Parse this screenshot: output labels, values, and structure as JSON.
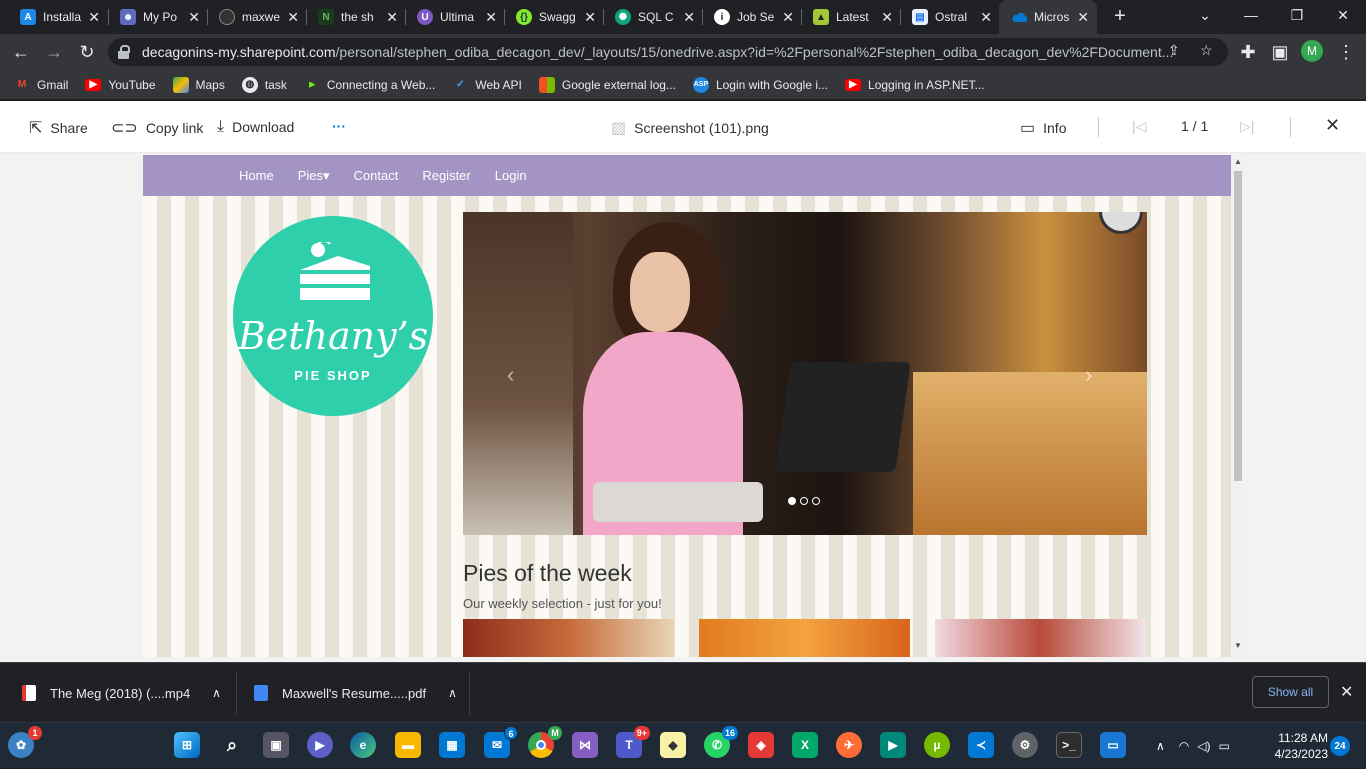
{
  "browser": {
    "tabs": [
      {
        "title": "Installa",
        "icon": "azure-icon",
        "color": "#1e88e5"
      },
      {
        "title": "My Po",
        "icon": "person-icon",
        "color": "#5c6bc0"
      },
      {
        "title": "maxwe",
        "icon": "github-icon",
        "color": "#333333"
      },
      {
        "title": "the sh",
        "icon": "nodejs-icon",
        "color": "#2e7d32"
      },
      {
        "title": "Ultima",
        "icon": "u-icon",
        "color": "#7e57c2"
      },
      {
        "title": "Swagg",
        "icon": "swagger-icon",
        "color": "#85ea2d"
      },
      {
        "title": "SQL C",
        "icon": "openai-icon",
        "color": "#10a37f"
      },
      {
        "title": "Job Se",
        "icon": "info-icon",
        "color": "#ffffff"
      },
      {
        "title": "Latest",
        "icon": "android-icon",
        "color": "#a4c639"
      },
      {
        "title": "Ostral",
        "icon": "doc-icon",
        "color": "#8ab4f8"
      },
      {
        "title": "Micros",
        "icon": "onedrive-icon",
        "color": "#0078d4",
        "active": true
      }
    ],
    "url_host": "decagonins-my.sharepoint.com",
    "url_path": "/personal/stephen_odiba_decagon_dev/_layouts/15/onedrive.aspx?id=%2Fpersonal%2Fstephen_odiba_decagon_dev%2FDocument...",
    "profile_initial": "M",
    "bookmarks": [
      {
        "label": "Gmail",
        "icon": "gmail-icon",
        "color": "#ea4335"
      },
      {
        "label": "YouTube",
        "icon": "youtube-icon",
        "color": "#ff0000"
      },
      {
        "label": "Maps",
        "icon": "maps-icon",
        "color": "#34a853"
      },
      {
        "label": "task",
        "icon": "globe-icon",
        "color": "#e8eaed"
      },
      {
        "label": "Connecting a Web...",
        "icon": "strapi-icon",
        "color": "#76ff03"
      },
      {
        "label": "Web API",
        "icon": "flutter-icon",
        "color": "#42a5f5"
      },
      {
        "label": "Google external log...",
        "icon": "microsoft-icon",
        "color": "#f25022"
      },
      {
        "label": "Login with Google i...",
        "icon": "aspnet-icon",
        "color": "#1e88e5"
      },
      {
        "label": "Logging in ASP.NET...",
        "icon": "youtube-icon",
        "color": "#ff0000"
      }
    ]
  },
  "onedrive": {
    "share": "Share",
    "copy_link": "Copy link",
    "download": "Download",
    "more": "···",
    "filename": "Screenshot (101).png",
    "info": "Info",
    "page_indicator": "1 / 1"
  },
  "site": {
    "nav": [
      "Home",
      "Pies▾",
      "Contact",
      "Register",
      "Login"
    ],
    "logo_name": "Bethany’s",
    "logo_sub": "PIE SHOP",
    "pies_title": "Pies of the week",
    "pies_sub": "Our weekly selection - just for you!"
  },
  "downloads": {
    "items": [
      {
        "name": "The Meg (2018) (....mp4",
        "color": "#e53935"
      },
      {
        "name": "Maxwell's Resume.....pdf",
        "color": "#4285f4"
      }
    ],
    "show_all": "Show all"
  },
  "taskbar": {
    "start_badge": "1",
    "mail_badge": "6",
    "teams_badge": "9+",
    "whatsapp_badge": "16",
    "time": "11:28 AM",
    "date": "4/23/2023",
    "notifications": "24",
    "chrome_profile": "M"
  }
}
